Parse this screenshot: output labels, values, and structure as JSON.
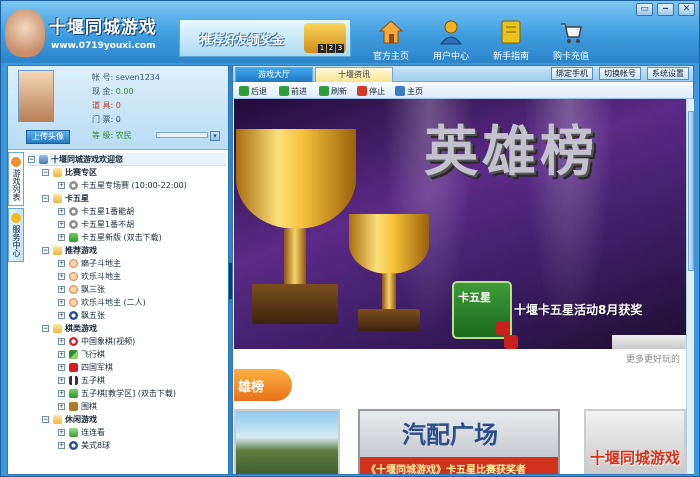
{
  "app": {
    "title": "十堰同城游戏",
    "url": "www.0719youxi.com",
    "banner_text": "推荐好友领奖金",
    "banner_numbers": [
      "1",
      "2",
      "3"
    ]
  },
  "nav": [
    {
      "label": "官方主页",
      "icon": "home-icon",
      "color": "#f4a93a"
    },
    {
      "label": "用户中心",
      "icon": "user-icon",
      "color": "#f2b31e"
    },
    {
      "label": "新手指南",
      "icon": "book-icon",
      "color": "#e9c31c"
    },
    {
      "label": "购卡充值",
      "icon": "cart-icon",
      "color": "#f4f4f4"
    }
  ],
  "window_controls": [
    "▭",
    "‒",
    "✕"
  ],
  "profile": {
    "upload_label": "上传头像",
    "fields": [
      {
        "label": "帐 号:",
        "value": "seven1234",
        "color": "#3d5670"
      },
      {
        "label": "现 金:",
        "value": "0.00",
        "color": "#2a8a2a"
      },
      {
        "label": "道 具:",
        "value": "0",
        "color": "#c0392b"
      },
      {
        "label": "门 票:",
        "value": "0",
        "color": "#3d5670"
      },
      {
        "label": "等 级:",
        "value": "农民",
        "color": "#2a8a2a"
      }
    ]
  },
  "vtabs": [
    {
      "label": "游戏列表",
      "icon": "game-list-icon",
      "color": "#f28d2b"
    },
    {
      "label": "服务中心",
      "icon": "service-icon",
      "color": "#f5b81e"
    }
  ],
  "tree": {
    "root": "十堰同城游戏欢迎您",
    "categories": [
      {
        "name": "比赛专区",
        "items": [
          {
            "label": "卡五星专场赛 (10:00-22:00)",
            "icon": "ico-game"
          }
        ]
      },
      {
        "name": "卡五星",
        "items": [
          {
            "label": "卡五星1番能胡",
            "icon": "ico-game"
          },
          {
            "label": "卡五星1番不胡",
            "icon": "ico-game"
          },
          {
            "label": "卡五星新版 (双击下载)",
            "icon": "ico-dl"
          }
        ]
      },
      {
        "name": "推荐游戏",
        "items": [
          {
            "label": "癞子斗地主",
            "icon": "ico-face"
          },
          {
            "label": "欢乐斗地主",
            "icon": "ico-face"
          },
          {
            "label": "飘三张",
            "icon": "ico-face"
          },
          {
            "label": "欢乐斗地主 (二人)",
            "icon": "ico-face"
          },
          {
            "label": "飘五张",
            "icon": "ico-ball"
          }
        ]
      },
      {
        "name": "棋类游戏",
        "items": [
          {
            "label": "中国象棋(视频)",
            "icon": "ico-chess"
          },
          {
            "label": "飞行棋",
            "icon": "ico-fly"
          },
          {
            "label": "四国军棋",
            "icon": "ico-flag"
          },
          {
            "label": "五子棋",
            "icon": "ico-gomoku"
          },
          {
            "label": "五子棋[教学区] (双击下载)",
            "icon": "ico-dl"
          },
          {
            "label": "围棋",
            "icon": "ico-go"
          }
        ]
      },
      {
        "name": "休闲游戏",
        "items": [
          {
            "label": "连连看",
            "icon": "ico-link"
          },
          {
            "label": "美式8球",
            "icon": "ico-ball"
          }
        ]
      }
    ]
  },
  "tabs": [
    "游戏大厅",
    "十堰资讯"
  ],
  "top_buttons": [
    "绑定手机",
    "切换帐号",
    "系统设置"
  ],
  "toolbar": [
    {
      "label": "后退",
      "icon": "back-icon",
      "color": "#2f9d3a"
    },
    {
      "label": "前进",
      "icon": "forward-icon",
      "color": "#2f9d3a"
    },
    {
      "label": "刷新",
      "icon": "refresh-icon",
      "color": "#2f9d3a"
    },
    {
      "label": "停止",
      "icon": "stop-icon",
      "color": "#d33a2a"
    },
    {
      "label": "主页",
      "icon": "home-icon",
      "color": "#3a7fc4"
    }
  ],
  "promo": {
    "hero_title": "英雄榜",
    "k5_logo_text": "卡五星",
    "activity_text": "十堰卡五星活动8月获奖",
    "more_text": "更多更好玩的",
    "ribbon_text": "雄榜",
    "thumb2_title": "汽配广场",
    "thumb2_sub": "《十堰同城游戏》卡五星比赛获奖者",
    "thumb3_text": "十堰同城游戏"
  }
}
